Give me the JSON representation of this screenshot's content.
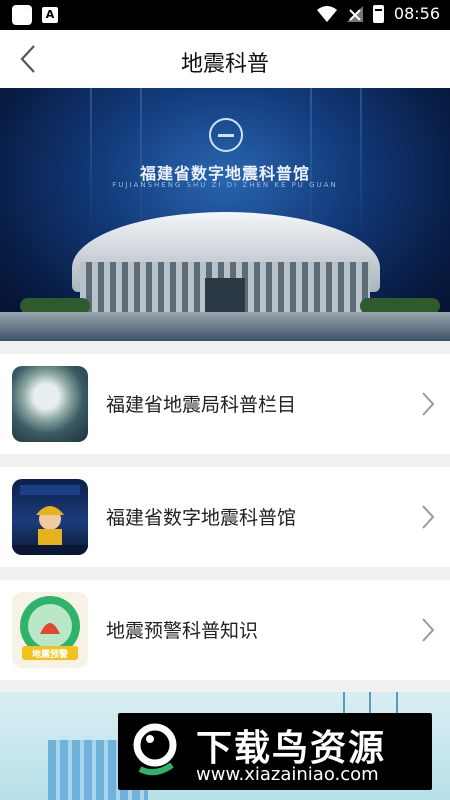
{
  "status_bar": {
    "time": "08:56",
    "badge_letter": "A"
  },
  "header": {
    "title": "地震科普"
  },
  "banner": {
    "name": "福建省数字地震科普馆",
    "pinyin": "FUJIANSHENG SHU ZI DI ZHEN KE PU GUAN"
  },
  "items": [
    {
      "label": "福建省地震局科普栏目",
      "icon": "globe-icon"
    },
    {
      "label": "福建省数字地震科普馆",
      "icon": "museum-mascot-icon"
    },
    {
      "label": "地震预警科普知识",
      "icon": "early-warning-icon"
    }
  ],
  "icon3_caption": "地震预警",
  "watermark": {
    "title": "下载鸟资源",
    "url": "www.xiazainiao.com"
  },
  "colors": {
    "banner_blue": "#123a7a",
    "accent_green": "#2db36a",
    "badge_yellow": "#f1c21b"
  }
}
